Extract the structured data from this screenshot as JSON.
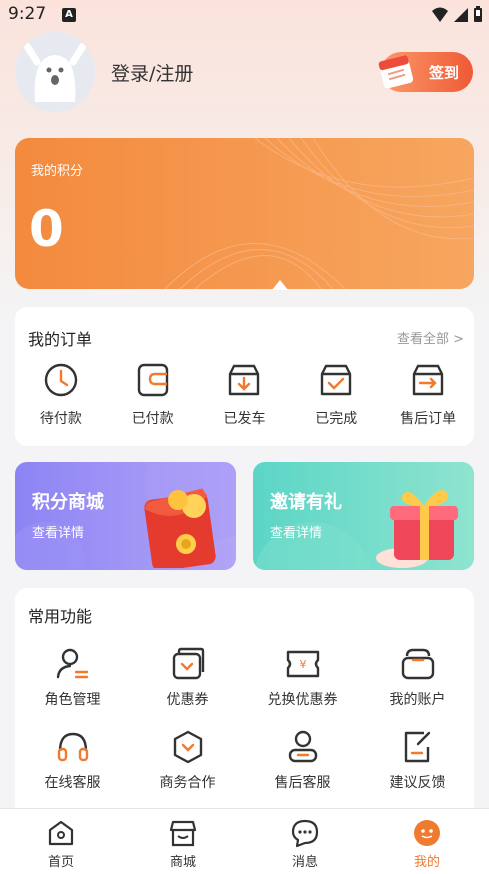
{
  "status_bar": {
    "time": "9:27",
    "notification_letter": "A"
  },
  "profile": {
    "login_label": "登录/注册",
    "signin_label": "签到"
  },
  "points": {
    "label": "我的积分",
    "value": "0"
  },
  "orders": {
    "title": "我的订单",
    "view_all": "查看全部 >",
    "items": [
      {
        "label": "待付款",
        "icon": "clock-icon"
      },
      {
        "label": "已付款",
        "icon": "wallet-icon"
      },
      {
        "label": "已发车",
        "icon": "box-download-icon"
      },
      {
        "label": "已完成",
        "icon": "box-check-icon"
      },
      {
        "label": "售后订单",
        "icon": "return-box-icon"
      }
    ]
  },
  "promos": {
    "mall": {
      "title": "积分商城",
      "subtitle": "查看详情"
    },
    "invite": {
      "title": "邀请有礼",
      "subtitle": "查看详情"
    }
  },
  "functions": {
    "title": "常用功能",
    "items": [
      {
        "label": "角色管理",
        "icon": "user-manage-icon"
      },
      {
        "label": "优惠券",
        "icon": "coupon-icon"
      },
      {
        "label": "兑换优惠券",
        "icon": "ticket-yen-icon"
      },
      {
        "label": "我的账户",
        "icon": "wallet-account-icon"
      },
      {
        "label": "在线客服",
        "icon": "headset-icon"
      },
      {
        "label": "商务合作",
        "icon": "hexagon-icon"
      },
      {
        "label": "售后客服",
        "icon": "user-service-icon"
      },
      {
        "label": "建议反馈",
        "icon": "feedback-icon"
      }
    ]
  },
  "tabs": [
    {
      "label": "首页",
      "icon": "home-icon"
    },
    {
      "label": "商城",
      "icon": "shop-icon"
    },
    {
      "label": "消息",
      "icon": "message-icon"
    },
    {
      "label": "我的",
      "icon": "profile-icon",
      "active": true
    }
  ],
  "colors": {
    "accent": "#f07a2f",
    "points_card": "#f38a3e",
    "promo_mall": "#8c84f4",
    "promo_invite": "#5cd5c6"
  }
}
